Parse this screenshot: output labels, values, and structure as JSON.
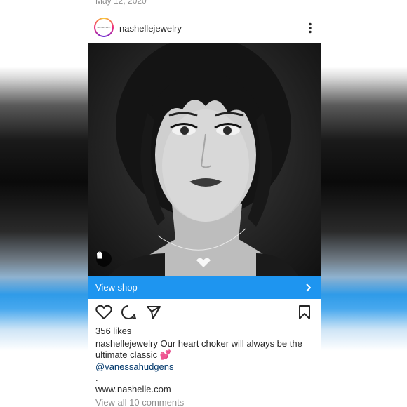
{
  "post": {
    "date": "May 12, 2020",
    "avatar_text": "NASHELLE",
    "username": "nashellejewelry",
    "view_shop_label": "View shop",
    "likes": "356 likes",
    "caption_user": "nashellejewelry",
    "caption_text": "Our heart choker will always be the ultimate classic",
    "caption_emoji": "💕",
    "mention": "@vanessahudgens",
    "dot": ".",
    "link": "www.nashelle.com",
    "view_comments": "View all 10 comments"
  },
  "icons": {
    "more": "more-options-icon",
    "shop": "shopping-bag-icon",
    "like": "heart-outline-icon",
    "comment": "comment-icon",
    "share": "paper-plane-icon",
    "save": "bookmark-icon",
    "chevron": "chevron-right-icon"
  },
  "colors": {
    "accent": "#1e95f0",
    "mention": "#00376b",
    "muted": "#8e8e8e",
    "text": "#262626"
  }
}
